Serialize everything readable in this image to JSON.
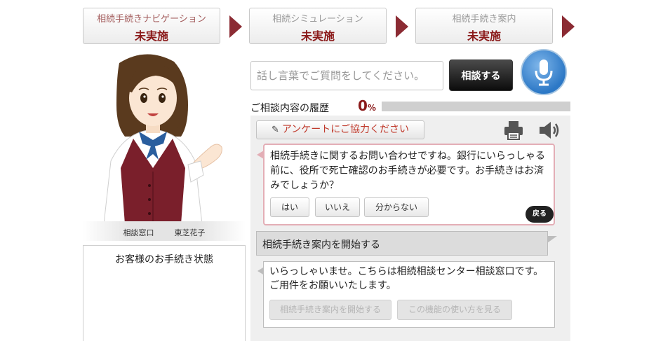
{
  "steps": [
    {
      "title": "相続手続きナビゲーション",
      "status": "未実施"
    },
    {
      "title": "相続シミュレーション",
      "status": "未実施"
    },
    {
      "title": "相続手続き案内",
      "status": "未実施"
    }
  ],
  "avatar": {
    "caption_role": "相談窓口",
    "caption_name": "東芝花子"
  },
  "status_panel": {
    "title": "お客様のお手続き状態"
  },
  "search": {
    "placeholder": "話し言葉でご質問をしてください。",
    "value": ""
  },
  "consult_button": "相談する",
  "history": {
    "label": "ご相談内容の履歴",
    "percent_value": "0",
    "percent_unit": "%",
    "progress": 0
  },
  "survey_button": "アンケートにご協力ください",
  "chat": {
    "bot_message_1": "相続手続きに関するお問い合わせですね。銀行にいらっしゃる前に、役所で死亡確認のお手続きが必要です。お手続きはお済みでしょうか？",
    "options_1": [
      "はい",
      "いいえ",
      "分からない"
    ],
    "back_button": "戻る",
    "user_message": "相続手続き案内を開始する",
    "bot_message_2": "いらっしゃいませ。こちらは相続相談センター相談窓口です。ご用件をお願いいたします。",
    "options_2": [
      "相続手続き案内を開始する",
      "この機能の使い方を見る"
    ]
  },
  "colors": {
    "accent": "#8b1a1a",
    "arrow": "#8b2b33",
    "mic": "#2c78c6",
    "survey_text": "#c0392b"
  }
}
